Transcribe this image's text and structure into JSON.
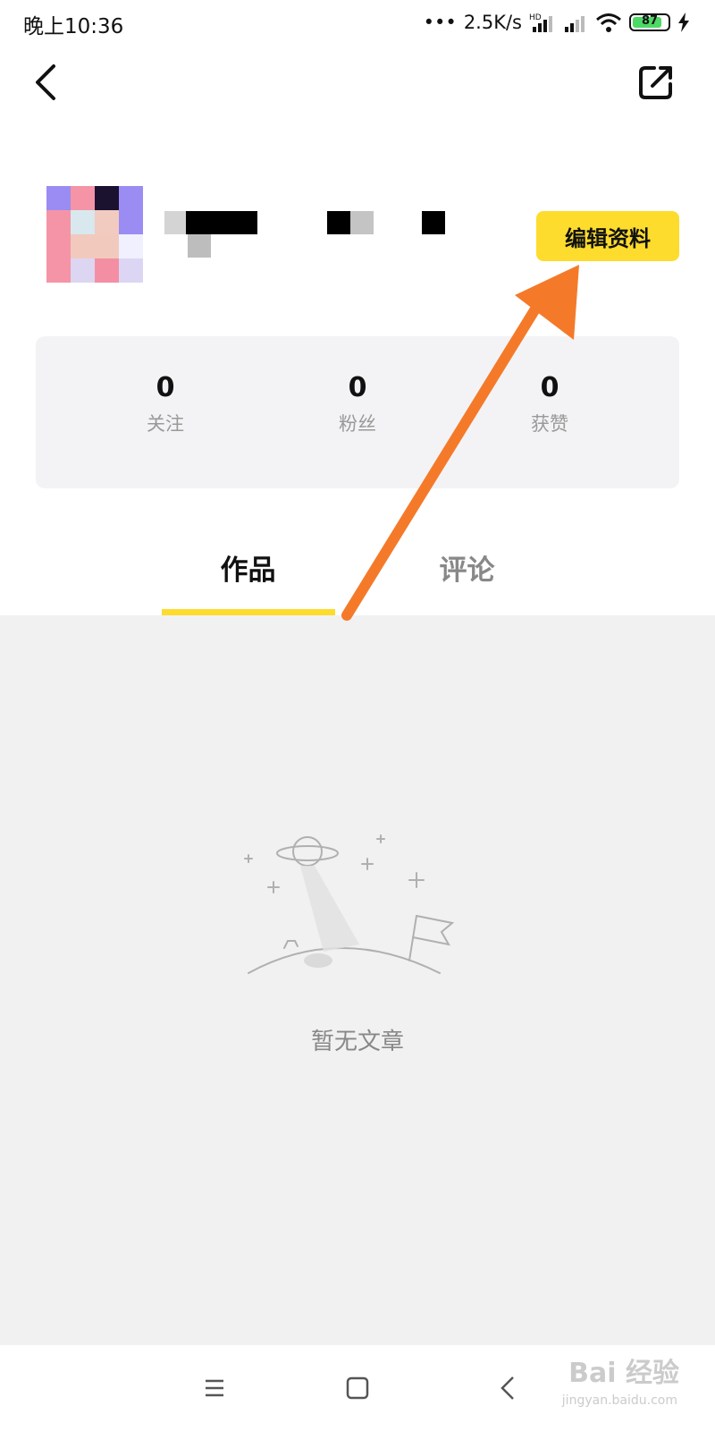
{
  "status_bar": {
    "time": "晚上10:36",
    "network_speed": "2.5K/s",
    "battery": "87",
    "battery_color": "#4cd964"
  },
  "header": {
    "back_icon": "chevron-left-icon",
    "share_icon": "share-external-icon"
  },
  "profile": {
    "edit_button_label": "编辑资料",
    "accent_color": "#fddc2d"
  },
  "stats": [
    {
      "value": "0",
      "label": "关注"
    },
    {
      "value": "0",
      "label": "粉丝"
    },
    {
      "value": "0",
      "label": "获赞"
    }
  ],
  "tabs": [
    {
      "label": "作品",
      "active": true
    },
    {
      "label": "评论",
      "active": false
    }
  ],
  "empty_state": {
    "text": "暂无文章",
    "icon": "planet-flag-illustration"
  },
  "nav_bar": {
    "menu_icon": "menu-icon",
    "home_icon": "home-square-icon",
    "back_icon": "nav-back-icon"
  },
  "watermark": {
    "text": "Bai 经验",
    "sub": "jingyan.baidu.com"
  },
  "annotation": {
    "color": "#f47a2a"
  }
}
